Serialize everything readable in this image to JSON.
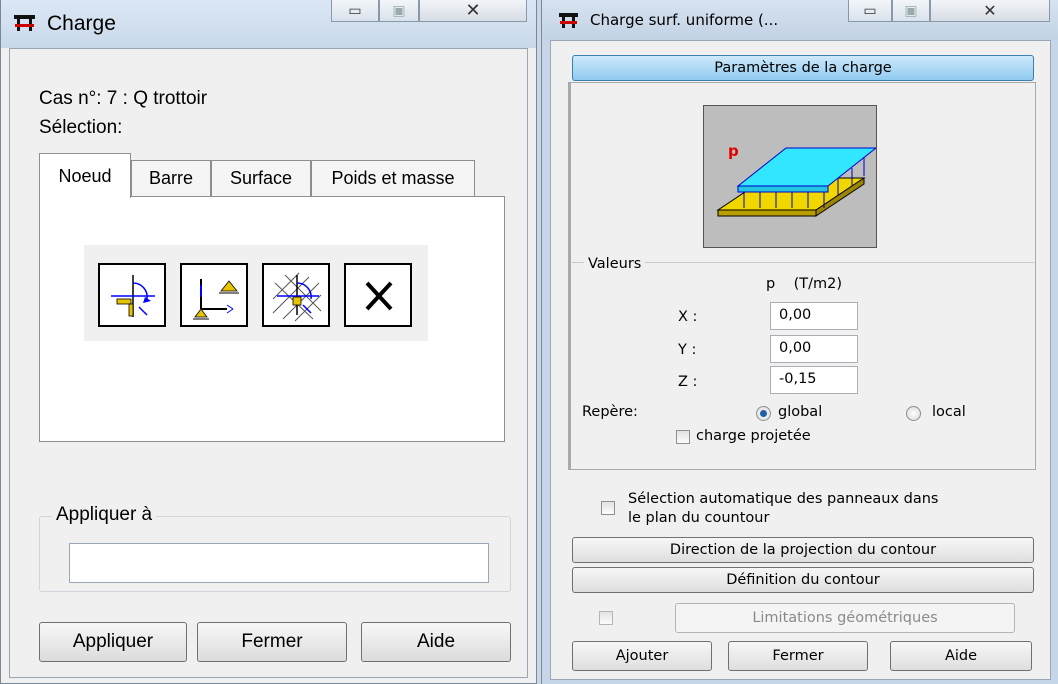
{
  "left_window": {
    "title": "Charge",
    "case_label": "Cas n°: 7 : Q trottoir",
    "selection_label": "Sélection:",
    "tabs": [
      {
        "label": "Noeud",
        "active": true
      },
      {
        "label": "Barre",
        "active": false
      },
      {
        "label": "Surface",
        "active": false
      },
      {
        "label": "Poids et masse",
        "active": false
      }
    ],
    "tools": [
      {
        "icon": "node-load-icon"
      },
      {
        "icon": "node-support-icon"
      },
      {
        "icon": "grid-node-icon"
      },
      {
        "icon": "delete-icon"
      }
    ],
    "apply_group_label": "Appliquer à",
    "apply_to_value": "",
    "buttons": {
      "apply": "Appliquer",
      "close": "Fermer",
      "help": "Aide"
    }
  },
  "right_window": {
    "title": "Charge surf. uniforme (...",
    "params_button": "Paramètres de la charge",
    "diagram_label": "p",
    "values_group_label": "Valeurs",
    "column_header": "p    (T/m2)",
    "fields": [
      {
        "label": "X :",
        "value": "0,00"
      },
      {
        "label": "Y :",
        "value": "0,00"
      },
      {
        "label": "Z :",
        "value": "-0,15"
      }
    ],
    "frame_label": "Repère:",
    "radio_global": "global",
    "radio_local": "local",
    "projected_load": "charge projetée",
    "auto_select_line1": "Sélection automatique des panneaux dans",
    "auto_select_line2": "le plan du countour",
    "btn_projection": "Direction de la projection du contour",
    "btn_contour": "Définition du contour",
    "btn_limits": "Limitations géométriques",
    "buttons": {
      "add": "Ajouter",
      "close": "Fermer",
      "help": "Aide"
    }
  },
  "colors": {
    "accent_blue": "#8fcaf0",
    "load_cyan": "#33e6ff",
    "slab_yellow": "#f2d600"
  }
}
